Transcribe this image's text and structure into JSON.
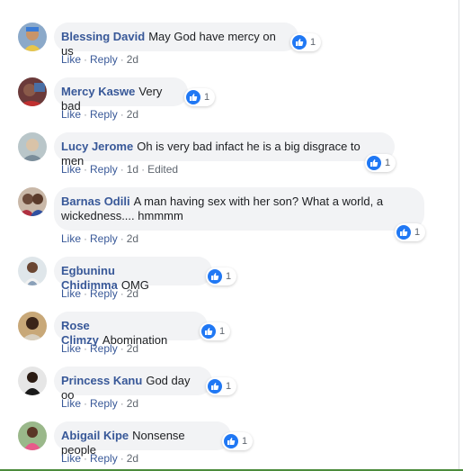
{
  "comments": [
    {
      "author": "Blessing David",
      "text": "May God have mercy on us",
      "reactions": "1",
      "like": "Like",
      "reply": "Reply",
      "time": "2d",
      "edited": ""
    },
    {
      "author": "Mercy Kaswe",
      "text": "Very bad",
      "reactions": "1",
      "like": "Like",
      "reply": "Reply",
      "time": "2d",
      "edited": ""
    },
    {
      "author": "Lucy Jerome",
      "text": "Oh is very bad infact he is a big disgrace to men",
      "reactions": "1",
      "like": "Like",
      "reply": "Reply",
      "time": "1d",
      "edited": "Edited"
    },
    {
      "author": "Barnas Odili",
      "text": "A man having sex with her son? What a world, a wickedness.... hmmmm",
      "reactions": "1",
      "like": "Like",
      "reply": "Reply",
      "time": "2d",
      "edited": ""
    },
    {
      "author": "Egbuninu Chidimma",
      "text": "OMG",
      "reactions": "1",
      "like": "Like",
      "reply": "Reply",
      "time": "2d",
      "edited": ""
    },
    {
      "author": "Rose Climzy",
      "text": "Abomination",
      "reactions": "1",
      "like": "Like",
      "reply": "Reply",
      "time": "2d",
      "edited": ""
    },
    {
      "author": "Princess Kanu",
      "text": "God day oo",
      "reactions": "1",
      "like": "Like",
      "reply": "Reply",
      "time": "2d",
      "edited": ""
    },
    {
      "author": "Abigail Kipe",
      "text": "Nonsense people",
      "reactions": "1",
      "like": "Like",
      "reply": "Reply",
      "time": "2d",
      "edited": ""
    }
  ],
  "colors": {
    "author": "#385898",
    "bubble": "#f2f3f5",
    "like_blue": "#2078f4",
    "meta": "#606770"
  },
  "icons": {
    "reaction": "thumbs-up-icon",
    "avatar": "avatar"
  }
}
